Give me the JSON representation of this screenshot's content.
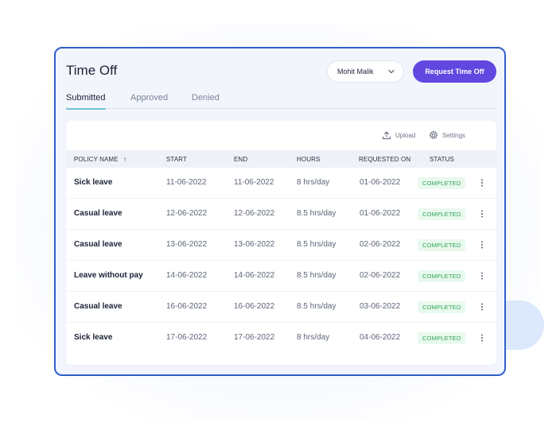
{
  "page": {
    "title": "Time Off"
  },
  "header": {
    "user_select_value": "Mohit Malik",
    "request_button_label": "Request Time Off"
  },
  "tabs": [
    {
      "label": "Submitted",
      "active": true
    },
    {
      "label": "Approved",
      "active": false
    },
    {
      "label": "Denied",
      "active": false
    }
  ],
  "toolbar": {
    "upload_label": "Upload",
    "settings_label": "Settings"
  },
  "table": {
    "columns": {
      "policy": "POLICY NAME",
      "sort_indicator": "↑",
      "start": "START",
      "end": "END",
      "hours": "HOURS",
      "requested_on": "REQUESTED ON",
      "status": "STATUS"
    },
    "rows": [
      {
        "policy": "Sick leave",
        "start": "11-06-2022",
        "end": "11-06-2022",
        "hours": "8 hrs/day",
        "requested_on": "01-06-2022",
        "status": "COMPLETED"
      },
      {
        "policy": "Casual leave",
        "start": "12-06-2022",
        "end": "12-06-2022",
        "hours": "8.5 hrs/day",
        "requested_on": "01-06-2022",
        "status": "COMPLETED"
      },
      {
        "policy": "Casual leave",
        "start": "13-06-2022",
        "end": "13-06-2022",
        "hours": "8.5 hrs/day",
        "requested_on": "02-06-2022",
        "status": "COMPLETED"
      },
      {
        "policy": "Leave without pay",
        "start": "14-06-2022",
        "end": "14-06-2022",
        "hours": "8.5 hrs/day",
        "requested_on": "02-06-2022",
        "status": "COMPLETED"
      },
      {
        "policy": "Casual leave",
        "start": "16-06-2022",
        "end": "16-06-2022",
        "hours": "8.5 hrs/day",
        "requested_on": "03-06-2022",
        "status": "COMPLETED"
      },
      {
        "policy": "Sick leave",
        "start": "17-06-2022",
        "end": "17-06-2022",
        "hours": "8 hrs/day",
        "requested_on": "04-06-2022",
        "status": "COMPLETED"
      }
    ]
  },
  "colors": {
    "accent": "#6247e0",
    "window_border": "#2f5fc9",
    "status_completed_text": "#2ea356",
    "status_completed_bg": "#e9f9ee",
    "tab_underline": "#6fc6d8"
  },
  "icons": {
    "user_select": "chevron-down-icon",
    "upload": "upload-icon",
    "settings": "gear-icon",
    "row_menu": "kebab-menu-icon"
  }
}
